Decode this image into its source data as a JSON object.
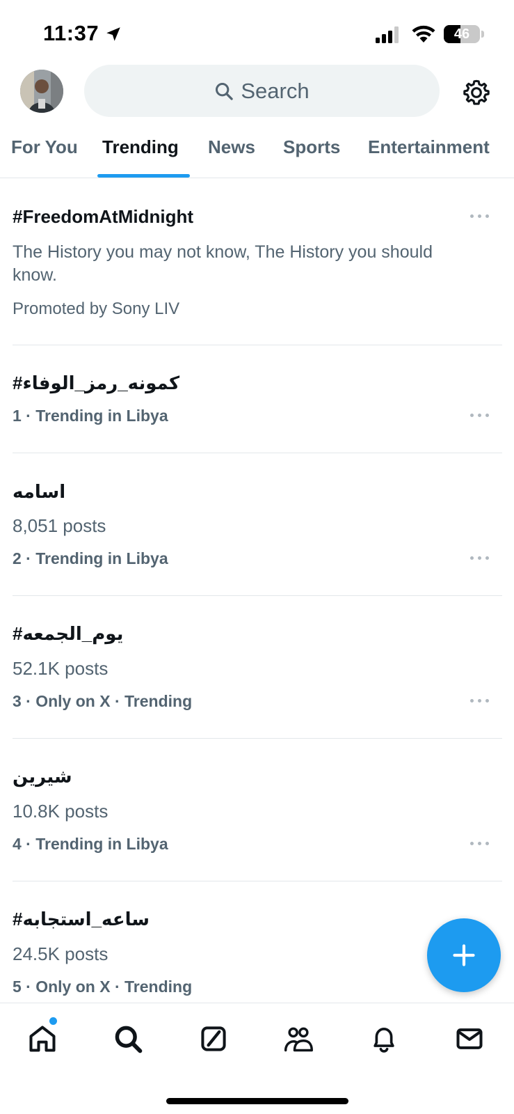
{
  "status_bar": {
    "time": "11:37",
    "battery": "46",
    "battery_level": 0.46,
    "icons": [
      "location-arrow-icon",
      "signal-icon",
      "wifi-icon",
      "battery-icon"
    ]
  },
  "header": {
    "search_placeholder": "Search",
    "settings_icon": "gear-icon",
    "search_icon": "search-icon"
  },
  "tabs": [
    {
      "label": "For You"
    },
    {
      "label": "Trending"
    },
    {
      "label": "News"
    },
    {
      "label": "Sports"
    },
    {
      "label": "Entertainment"
    }
  ],
  "active_tab": "Trending",
  "promoted": {
    "title": "#FreedomAtMidnight",
    "description": "The History you may not know, The History you should know.",
    "promoted_by": "Promoted by Sony LIV"
  },
  "trends": [
    {
      "rank": "1",
      "context": "Trending in Libya",
      "title": "#كمونه_رمز_الوفاء",
      "posts": ""
    },
    {
      "rank": "2",
      "context": "Trending in Libya",
      "title": "اسامه",
      "posts": "8,051 posts"
    },
    {
      "rank": "3",
      "context": "Only on X · Trending",
      "title": "#يوم_الجمعه",
      "posts": "52.1K posts"
    },
    {
      "rank": "4",
      "context": "Trending in Libya",
      "title": "شيرين",
      "posts": "10.8K posts"
    },
    {
      "rank": "5",
      "context": "Only on X · Trending",
      "title": "#ساعه_استجابه",
      "posts": "24.5K posts"
    }
  ],
  "trend_meta": [
    "1 · Trending in Libya",
    "2 · Trending in Libya",
    "3 · Only on X · Trending",
    "4 · Trending in Libya",
    "5 · Only on X · Trending"
  ],
  "fab": {
    "icon": "plus-icon"
  },
  "bottom_nav": [
    {
      "name": "home",
      "icon": "home-icon",
      "has_notification": true
    },
    {
      "name": "search",
      "icon": "search-icon"
    },
    {
      "name": "grok",
      "icon": "grok-icon"
    },
    {
      "name": "communities",
      "icon": "communities-icon"
    },
    {
      "name": "notifications",
      "icon": "bell-icon"
    },
    {
      "name": "messages",
      "icon": "mail-icon"
    }
  ],
  "colors": {
    "accent": "#1d9bf0",
    "text_primary": "#0f1419",
    "text_secondary": "#536471",
    "divider": "#e3e7ea",
    "search_bg": "#eff3f4"
  }
}
